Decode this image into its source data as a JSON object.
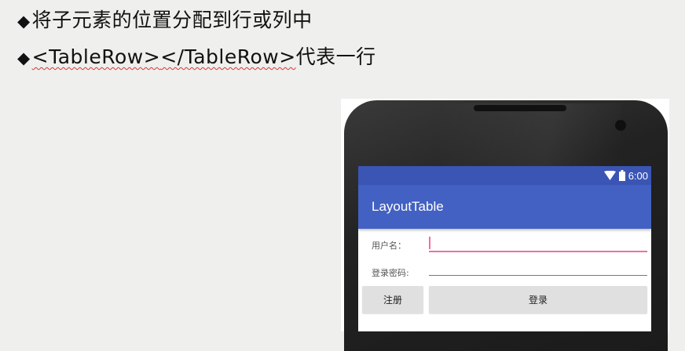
{
  "slide": {
    "bullet_mark": "◆",
    "line1": "将子元素的位置分配到行或列中",
    "line2_tag1": "<TableRow>",
    "line2_tag2": "</TableRow>",
    "line2_suffix": "代表一行"
  },
  "phone": {
    "status_time": "6:00",
    "app_title": "LayoutTable",
    "form": {
      "username_label": "用户名：",
      "username_value": "",
      "password_label": "登录密码:",
      "password_value": "",
      "register_label": "注册",
      "login_label": "登录"
    },
    "colors": {
      "statusbar": "#3a55b4",
      "appbar": "#4361c2",
      "focus_underline": "#ef6ea3"
    }
  }
}
